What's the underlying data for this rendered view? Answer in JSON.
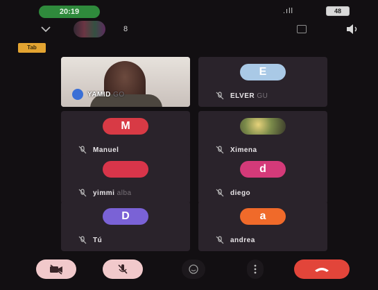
{
  "status_bar": {
    "time": "20:19",
    "signal": ".ıll",
    "battery": "48"
  },
  "header": {
    "participant_count": "8"
  },
  "badge": {
    "label": "Tab"
  },
  "tiles": [
    {
      "name": "YAMID",
      "name_faded": " GO",
      "avatar_letter": "",
      "type": "video"
    },
    {
      "name": "ELVER",
      "name_faded": " GU",
      "avatar_letter": "E",
      "avatar_color": "#a9c9e6",
      "type": "letter"
    },
    {
      "name": "Manuel",
      "name_faded": "",
      "avatar_letter": "M",
      "avatar_color": "#d83a45",
      "type": "letter"
    },
    {
      "name": "Ximena",
      "name_faded": "",
      "avatar_letter": "",
      "type": "photo"
    },
    {
      "name": "yimmi",
      "name_faded": " alba",
      "avatar_letter": "",
      "avatar_color": "#d8354a",
      "type": "letter"
    },
    {
      "name": "diego",
      "name_faded": "",
      "avatar_letter": "d",
      "avatar_color": "#d43a79",
      "type": "letter"
    },
    {
      "name": "Tú",
      "name_faded": "",
      "avatar_letter": "D",
      "avatar_color": "#7a62d6",
      "type": "letter"
    },
    {
      "name": "andrea",
      "name_faded": "",
      "avatar_letter": "a",
      "avatar_color": "#f06a2a",
      "type": "letter"
    }
  ],
  "colors": {
    "background": "#120f12",
    "tile": "#2a232b",
    "leave": "#e2453a",
    "muted_button": "#f1c9cb"
  }
}
